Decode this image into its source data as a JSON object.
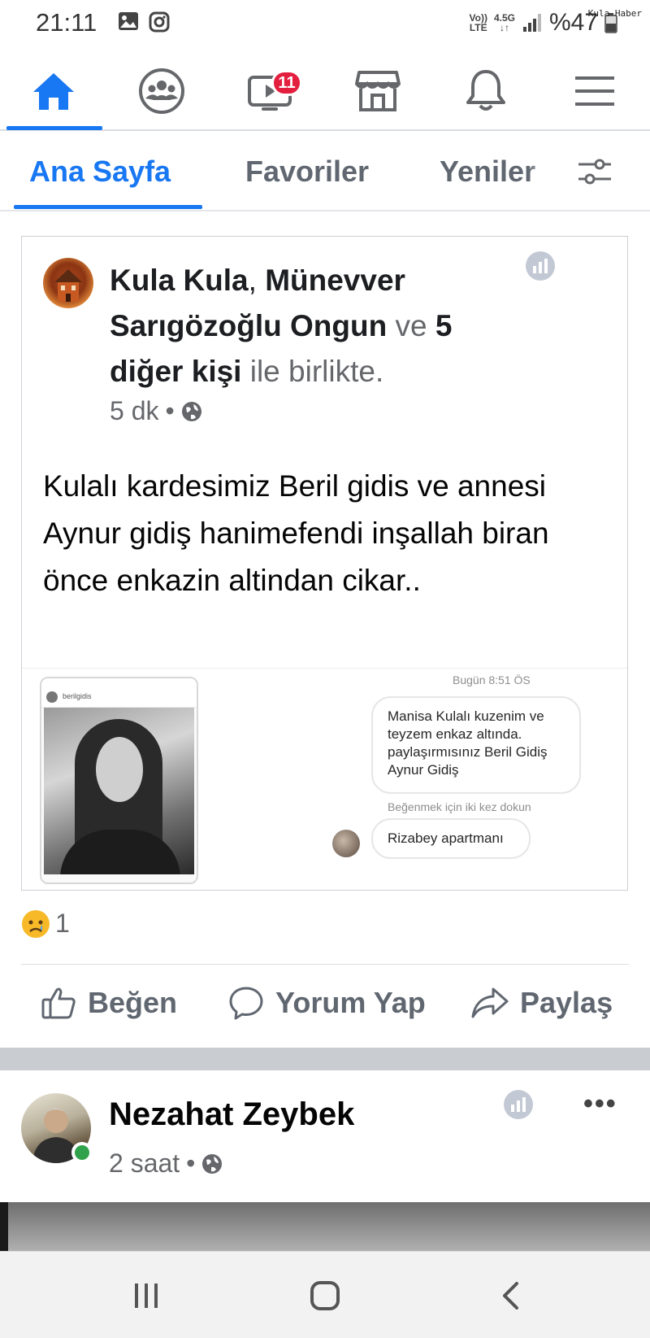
{
  "status_bar": {
    "time": "21:11",
    "network_top": "Vo))",
    "network_bottom": "LTE",
    "data_speed": "4.5G",
    "battery": "%47",
    "watermark": "Kula Haber"
  },
  "top_nav": {
    "items": [
      "home",
      "groups",
      "watch",
      "marketplace",
      "notifications",
      "menu"
    ],
    "active": "home",
    "watch_badge": "11",
    "accent_color": "#1877f2",
    "badge_color": "#e41e3f"
  },
  "feed_tabs": {
    "tabs": [
      {
        "label": "Ana Sayfa",
        "active": true
      },
      {
        "label": "Favoriler",
        "active": false
      },
      {
        "label": "Yeniler",
        "active": false
      }
    ]
  },
  "post1": {
    "author_1": "Kula Kula",
    "separator": ",",
    "author_2": "Münevver Sarıgözoğlu Ongun",
    "connector": "ve",
    "others": "5 diğer kişi",
    "suffix": "ile birlikte.",
    "time": "5 dk",
    "dot": "•",
    "text": "Kulalı kardesimiz Beril gidis ve annesi Aynur gidiş hanimefendi inşallah biran önce enkazin altindan cikar..",
    "embed": {
      "chat_time": "Bugün 8:51 ÖS",
      "message_1": "Manisa Kulalı kuzenim ve teyzem enkaz altında. paylaşırmısınız Beril Gidiş Aynur Gidiş",
      "hint": "Beğenmek için iki kez dokun",
      "message_2": "Rizabey apartmanı",
      "profile_handle": "berilgidis"
    },
    "reaction_count": "1",
    "actions": {
      "like": "Beğen",
      "comment": "Yorum Yap",
      "share": "Paylaş"
    }
  },
  "post2": {
    "author": "Nezahat Zeybek",
    "time": "2 saat",
    "dot": "•",
    "more": "•••",
    "online_color": "#31a24c"
  },
  "android_nav": {
    "items": [
      "recent-apps",
      "home",
      "back"
    ]
  }
}
